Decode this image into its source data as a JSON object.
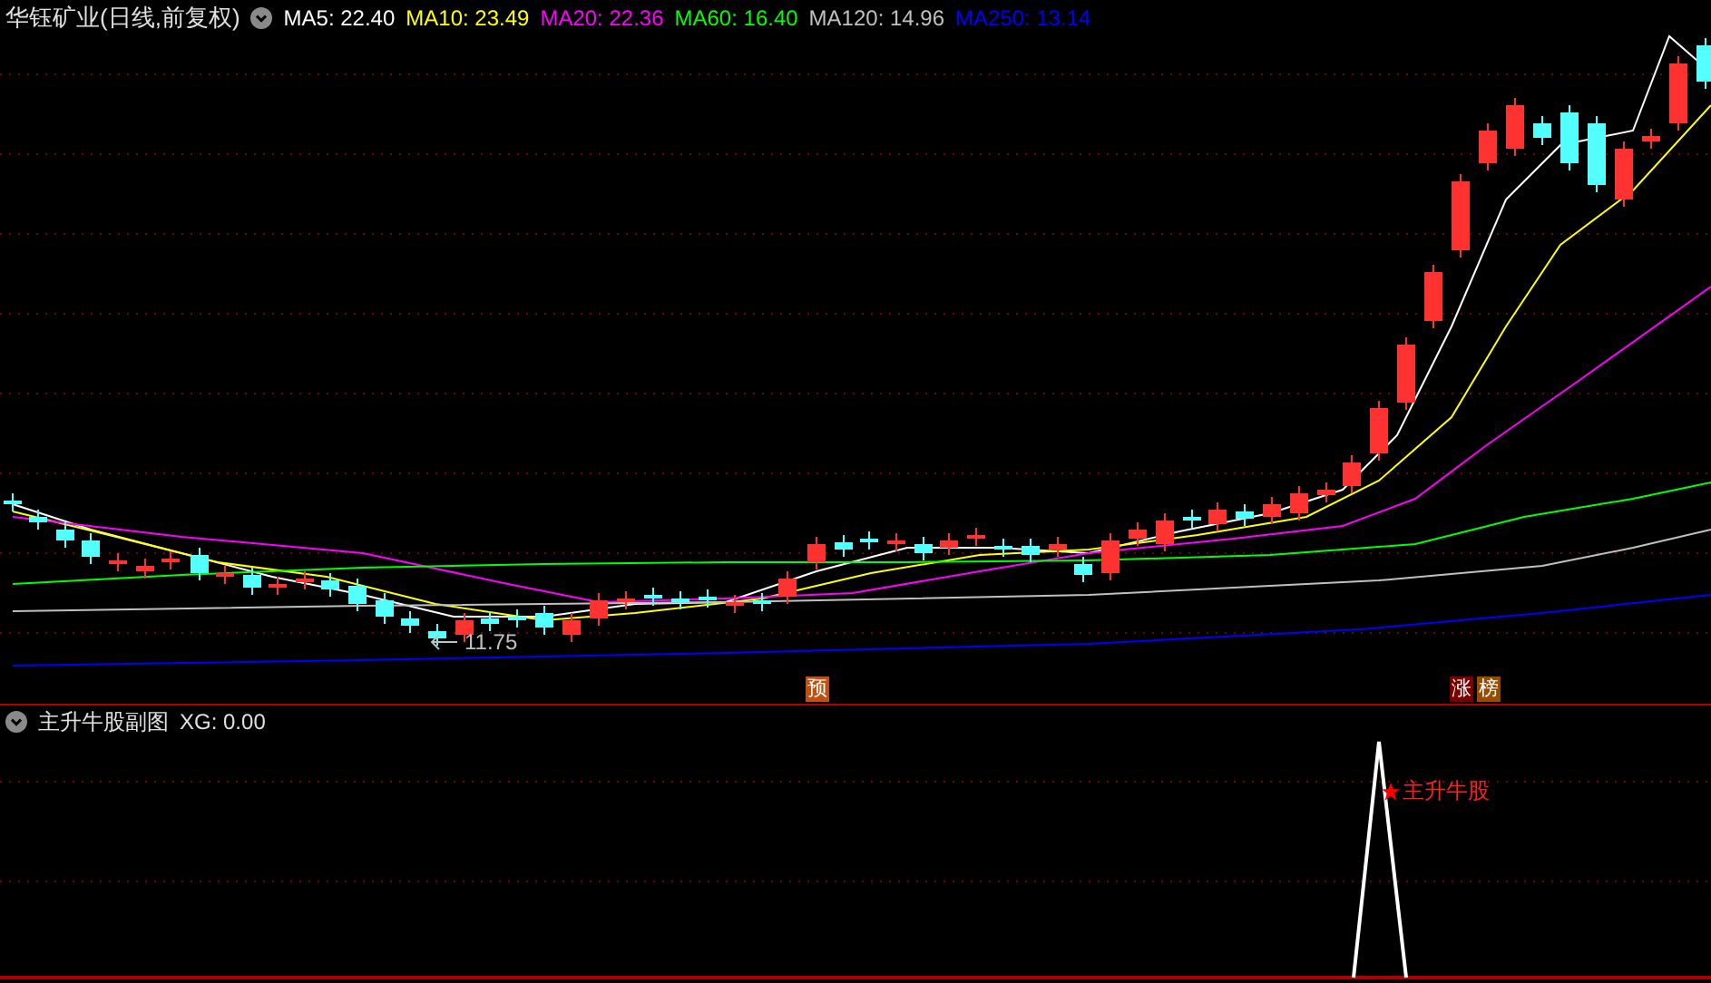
{
  "main_chart": {
    "title": "华钰矿业(日线,前复权)",
    "indicators": [
      {
        "label": "MA5: 22.40",
        "color": "#ffffff"
      },
      {
        "label": "MA10: 23.49",
        "color": "#ffff00"
      },
      {
        "label": "MA20: 22.36",
        "color": "#ff00ff"
      },
      {
        "label": "MA60: 16.40",
        "color": "#00ff00"
      },
      {
        "label": "MA120: 14.96",
        "color": "#c0c0c0"
      },
      {
        "label": "MA250: 13.14",
        "color": "#0000ff"
      }
    ],
    "low_price_label": "11.75",
    "markers": [
      {
        "text": "预",
        "color": "#c0500f"
      },
      {
        "text": "涨",
        "color": "#7a0000"
      },
      {
        "text": "榜",
        "color": "#9a4a00"
      }
    ]
  },
  "sub_chart": {
    "title": "主升牛股副图",
    "reading": "XG: 0.00",
    "signal_label": "主升牛股"
  }
}
